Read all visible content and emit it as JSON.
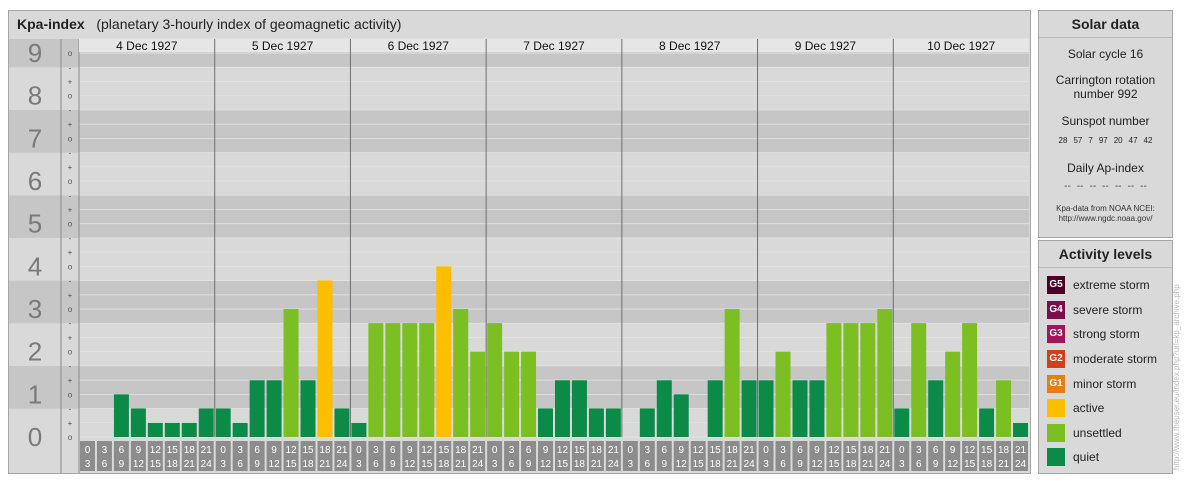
{
  "title": {
    "main": "Kpa-index",
    "subtitle": "(planetary 3-hourly index of geomagnetic activity)"
  },
  "colors": {
    "quiet": "#0c8a48",
    "unsettled": "#7bbf23",
    "active": "#fbbf00"
  },
  "chart_data": {
    "type": "bar",
    "days": [
      "4 Dec 1927",
      "5 Dec 1927",
      "6 Dec 1927",
      "7 Dec 1927",
      "8 Dec 1927",
      "9 Dec 1927",
      "10 Dec 1927"
    ],
    "y_major_labels": [
      "0",
      "1",
      "2",
      "3",
      "4",
      "5",
      "6",
      "7",
      "8",
      "9"
    ],
    "y_minor_labels": [
      "o",
      "+",
      "-",
      "o",
      "+",
      "-",
      "o",
      "+",
      "-",
      "o",
      "+",
      "-",
      "o",
      "+",
      "-",
      "o",
      "+",
      "-",
      "o",
      "+",
      "-",
      "o",
      "+",
      "-",
      "o",
      "+",
      "-",
      "o"
    ],
    "interval_top": [
      "0",
      "3",
      "6",
      "9",
      "12",
      "15",
      "18",
      "21"
    ],
    "interval_bottom": [
      "3",
      "6",
      "9",
      "12",
      "15",
      "18",
      "21",
      "24"
    ],
    "ylim": [
      0,
      9.33
    ],
    "values": [
      0,
      0,
      1.0,
      0.67,
      0.33,
      0.33,
      0.33,
      0.67,
      0.67,
      0.33,
      1.33,
      1.33,
      3.0,
      1.33,
      3.67,
      0.67,
      0.33,
      2.67,
      2.67,
      2.67,
      2.67,
      4.0,
      3.0,
      2.0,
      2.67,
      2.0,
      2.0,
      0.67,
      1.33,
      1.33,
      0.67,
      0.67,
      0,
      0.67,
      1.33,
      1.0,
      0,
      1.33,
      3.0,
      1.33,
      1.33,
      2.0,
      1.33,
      1.33,
      2.67,
      2.67,
      2.67,
      3.0,
      0.67,
      2.67,
      1.33,
      2.0,
      2.67,
      0.67,
      1.33,
      0.33
    ],
    "levels": [
      "quiet",
      "quiet",
      "quiet",
      "quiet",
      "quiet",
      "quiet",
      "quiet",
      "quiet",
      "quiet",
      "quiet",
      "quiet",
      "quiet",
      "unsettled",
      "quiet",
      "active",
      "quiet",
      "quiet",
      "unsettled",
      "unsettled",
      "unsettled",
      "unsettled",
      "active",
      "unsettled",
      "unsettled",
      "unsettled",
      "unsettled",
      "unsettled",
      "quiet",
      "quiet",
      "quiet",
      "quiet",
      "quiet",
      "quiet",
      "quiet",
      "quiet",
      "quiet",
      "quiet",
      "quiet",
      "unsettled",
      "quiet",
      "quiet",
      "unsettled",
      "quiet",
      "quiet",
      "unsettled",
      "unsettled",
      "unsettled",
      "unsettled",
      "quiet",
      "unsettled",
      "quiet",
      "unsettled",
      "unsettled",
      "quiet",
      "unsettled",
      "quiet"
    ]
  },
  "solar": {
    "heading": "Solar data",
    "cycle": "Solar cycle 16",
    "carrington_1": "Carrington rotation",
    "carrington_2": "number 992",
    "sunspot_heading": "Sunspot number",
    "sunspots": [
      "28",
      "57",
      "7",
      "97",
      "20",
      "47",
      "42"
    ],
    "ap_heading": "Daily Ap-index",
    "ap_values": [
      "--",
      "--",
      "--",
      "--",
      "--",
      "--",
      "--"
    ],
    "source_1": "Kpa-data from NOAA NCEI:",
    "source_2": "http://www.ngdc.noaa.gov/"
  },
  "activity": {
    "heading": "Activity levels",
    "levels": [
      {
        "code": "G5",
        "label": "extreme storm",
        "color": "#4d0026"
      },
      {
        "code": "G4",
        "label": "severe storm",
        "color": "#7a0d4a"
      },
      {
        "code": "G3",
        "label": "strong storm",
        "color": "#a3145b"
      },
      {
        "code": "G2",
        "label": "moderate storm",
        "color": "#d2401a"
      },
      {
        "code": "G1",
        "label": "minor storm",
        "color": "#e87d14"
      },
      {
        "code": "",
        "label": "active",
        "color": "#fbbf00"
      },
      {
        "code": "",
        "label": "unsettled",
        "color": "#7bbf23"
      },
      {
        "code": "",
        "label": "quiet",
        "color": "#0c8a48"
      }
    ]
  },
  "watermark": "http://www.theuser.eu/index.php?url=kp_archive.php"
}
